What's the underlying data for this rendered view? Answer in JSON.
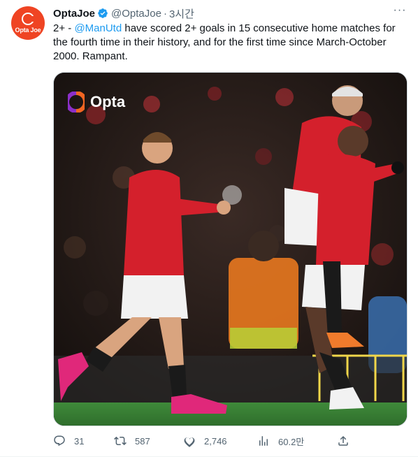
{
  "tweet": {
    "display_name": "OptaJoe",
    "handle": "@OptaJoe",
    "separator": "·",
    "time": "3시간",
    "avatar_text": "Opta Joe",
    "text_before": "2+ - ",
    "mention": "@ManUtd",
    "text_after": " have scored 2+ goals in 15 consecutive home matches for the fourth time in their history, and for the first time since March-October 2000. Rampant.",
    "more_icon": "more-icon"
  },
  "media": {
    "watermark": "Opta",
    "colors": {
      "shirt_red": "#d4202c",
      "opta_orange": "#f26522",
      "opta_purple": "#8b2fc9"
    }
  },
  "actions": {
    "replies": "31",
    "retweets": "587",
    "likes": "2,746",
    "views": "60.2만"
  },
  "colors": {
    "accent": "#1d9bf0",
    "secondary": "#536471"
  }
}
